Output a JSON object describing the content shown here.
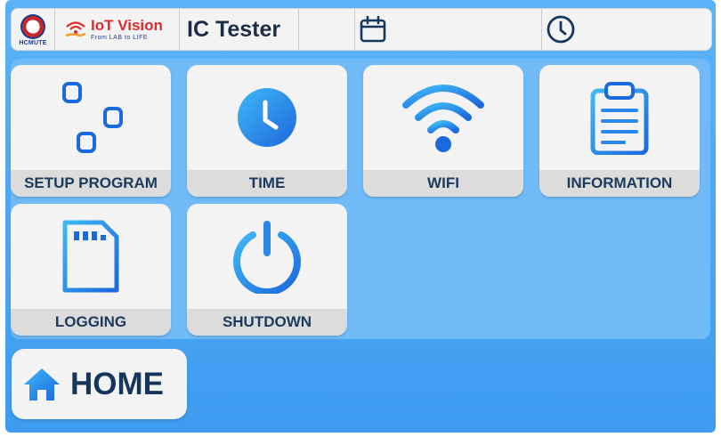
{
  "header": {
    "logo_text": "HCMUTE",
    "brand_name": "IoT Vision",
    "brand_tagline": "From LAB to LIFE",
    "title": "IC Tester",
    "date_icon": "calendar-icon",
    "time_icon": "clock-icon"
  },
  "tiles": [
    {
      "label": "SETUP PROGRAM",
      "icon": "sliders-icon"
    },
    {
      "label": "TIME",
      "icon": "clock-icon"
    },
    {
      "label": "WIFI",
      "icon": "wifi-icon"
    },
    {
      "label": "INFORMATION",
      "icon": "clipboard-icon"
    },
    {
      "label": "LOGGING",
      "icon": "sd-card-icon"
    },
    {
      "label": "SHUTDOWN",
      "icon": "power-icon"
    }
  ],
  "home": {
    "label": "HOME",
    "icon": "home-icon"
  },
  "colors": {
    "frame": "#3e9cf0",
    "panel": "#6fbaf7",
    "icon_gradient_top": "#3fb0f3",
    "icon_gradient_bottom": "#1f6fe0",
    "label_text": "#1b3a5c"
  }
}
